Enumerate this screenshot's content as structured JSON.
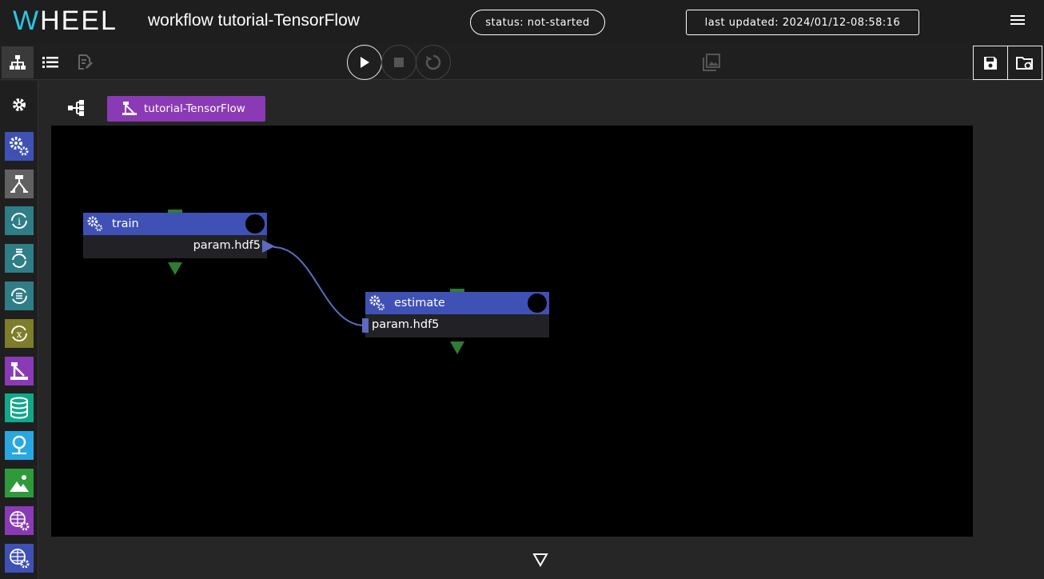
{
  "header": {
    "logo_first": "W",
    "logo_rest": "HEEL",
    "title": "workflow tutorial-TensorFlow",
    "status": "status: not-started",
    "last_updated": "last updated: 2024/01/12-08:58:16"
  },
  "breadcrumb": {
    "label": "tutorial-TensorFlow"
  },
  "nodes": [
    {
      "name": "train",
      "output": "param.hdf5"
    },
    {
      "name": "estimate",
      "input": "param.hdf5"
    }
  ],
  "palette": [
    {
      "name": "task",
      "color": "#3f51b5"
    },
    {
      "name": "if",
      "color": "#616161"
    },
    {
      "name": "for",
      "color": "#2f7d86"
    },
    {
      "name": "while",
      "color": "#2f7d86"
    },
    {
      "name": "foreach",
      "color": "#2f7d86"
    },
    {
      "name": "parameterStudy",
      "color": "#7d7d2a"
    },
    {
      "name": "workflow",
      "color": "#8a3ab4"
    },
    {
      "name": "storage",
      "color": "#11a88a"
    },
    {
      "name": "source",
      "color": "#29a8e0"
    },
    {
      "name": "viewer",
      "color": "#2e9a3a"
    },
    {
      "name": "stepjob",
      "color": "#8a3ab4"
    },
    {
      "name": "bulkjobTask",
      "color": "#3f51b5"
    }
  ]
}
